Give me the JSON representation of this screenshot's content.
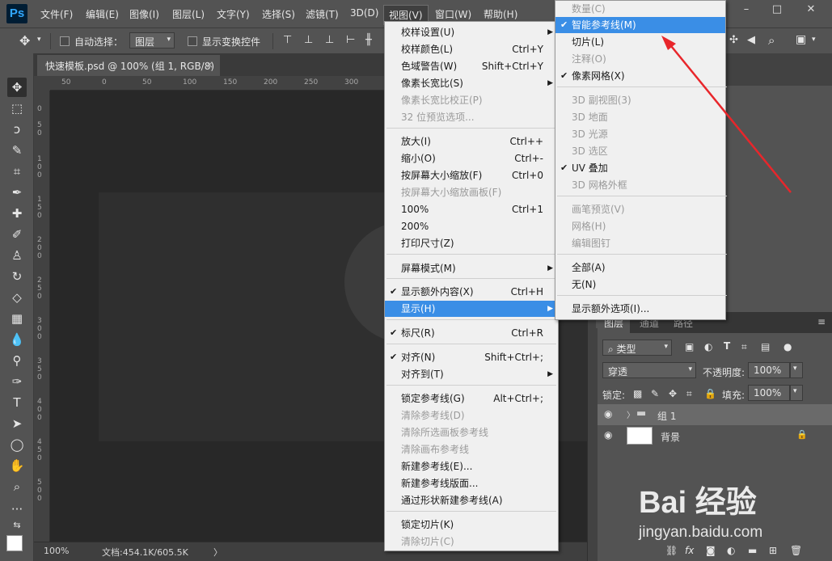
{
  "app": {
    "logo": "Ps",
    "colors": {
      "menu_highlight": "#3a8ee6",
      "menu_bg": "#f0f0f0",
      "ui_dark": "#535353",
      "annotation_arrow": "#e8262b"
    }
  },
  "menubar": {
    "items": [
      "文件(F)",
      "编辑(E)",
      "图像(I)",
      "图层(L)",
      "文字(Y)",
      "选择(S)",
      "滤镜(T)",
      "3D(D)",
      "视图(V)",
      "窗口(W)",
      "帮助(H)"
    ],
    "active": "视图(V)",
    "window_buttons": [
      "–",
      "□",
      "✕"
    ]
  },
  "options_bar": {
    "auto_select_label": "自动选择：",
    "auto_select_target": "图层",
    "show_transform_label": "显示变换控件"
  },
  "document": {
    "tab_title": "快速模板.psd @ 100% (组 1, RGB/8)",
    "tab_close": "×",
    "ruler_h_ticks": [
      "50",
      "0",
      "50",
      "100",
      "150",
      "200",
      "250",
      "300",
      "350"
    ],
    "ruler_v_ticks": [
      "0",
      "5 0",
      "1 0 0",
      "1 5 0",
      "2 0 0",
      "2 5 0",
      "3 0 0",
      "3 5 0",
      "4 0 0",
      "4 5 0",
      "5 0 0"
    ]
  },
  "status_bar": {
    "zoom": "100%",
    "doc_info": "文档:454.1K/605.5K",
    "arrow": "〉"
  },
  "view_menu": {
    "items": [
      {
        "label": "校样设置(U)",
        "shortcut": "",
        "submenu": true,
        "disabled": false,
        "checked": false
      },
      {
        "label": "校样颜色(L)",
        "shortcut": "Ctrl+Y",
        "submenu": false,
        "disabled": false,
        "checked": false
      },
      {
        "label": "色域警告(W)",
        "shortcut": "Shift+Ctrl+Y",
        "submenu": false,
        "disabled": false,
        "checked": false
      },
      {
        "label": "像素长宽比(S)",
        "shortcut": "",
        "submenu": true,
        "disabled": false,
        "checked": false
      },
      {
        "label": "像素长宽比校正(P)",
        "shortcut": "",
        "submenu": false,
        "disabled": true,
        "checked": false
      },
      {
        "label": "32 位预览选项...",
        "shortcut": "",
        "submenu": false,
        "disabled": true,
        "checked": false
      },
      {
        "label": "放大(I)",
        "shortcut": "Ctrl++",
        "submenu": false,
        "disabled": false,
        "checked": false
      },
      {
        "label": "缩小(O)",
        "shortcut": "Ctrl+-",
        "submenu": false,
        "disabled": false,
        "checked": false
      },
      {
        "label": "按屏幕大小缩放(F)",
        "shortcut": "Ctrl+0",
        "submenu": false,
        "disabled": false,
        "checked": false
      },
      {
        "label": "按屏幕大小缩放画板(F)",
        "shortcut": "",
        "submenu": false,
        "disabled": true,
        "checked": false
      },
      {
        "label": "100%",
        "shortcut": "Ctrl+1",
        "submenu": false,
        "disabled": false,
        "checked": false
      },
      {
        "label": "200%",
        "shortcut": "",
        "submenu": false,
        "disabled": false,
        "checked": false
      },
      {
        "label": "打印尺寸(Z)",
        "shortcut": "",
        "submenu": false,
        "disabled": false,
        "checked": false
      },
      {
        "label": "屏幕模式(M)",
        "shortcut": "",
        "submenu": true,
        "disabled": false,
        "checked": false
      },
      {
        "label": "显示额外内容(X)",
        "shortcut": "Ctrl+H",
        "submenu": false,
        "disabled": false,
        "checked": true
      },
      {
        "label": "显示(H)",
        "shortcut": "",
        "submenu": true,
        "disabled": false,
        "checked": false,
        "highlighted": true
      },
      {
        "label": "标尺(R)",
        "shortcut": "Ctrl+R",
        "submenu": false,
        "disabled": false,
        "checked": true
      },
      {
        "label": "对齐(N)",
        "shortcut": "Shift+Ctrl+;",
        "submenu": false,
        "disabled": false,
        "checked": true
      },
      {
        "label": "对齐到(T)",
        "shortcut": "",
        "submenu": true,
        "disabled": false,
        "checked": false
      },
      {
        "label": "锁定参考线(G)",
        "shortcut": "Alt+Ctrl+;",
        "submenu": false,
        "disabled": false,
        "checked": false
      },
      {
        "label": "清除参考线(D)",
        "shortcut": "",
        "submenu": false,
        "disabled": true,
        "checked": false
      },
      {
        "label": "清除所选画板参考线",
        "shortcut": "",
        "submenu": false,
        "disabled": true,
        "checked": false
      },
      {
        "label": "清除画布参考线",
        "shortcut": "",
        "submenu": false,
        "disabled": true,
        "checked": false
      },
      {
        "label": "新建参考线(E)...",
        "shortcut": "",
        "submenu": false,
        "disabled": false,
        "checked": false
      },
      {
        "label": "新建参考线版面...",
        "shortcut": "",
        "submenu": false,
        "disabled": false,
        "checked": false
      },
      {
        "label": "通过形状新建参考线(A)",
        "shortcut": "",
        "submenu": false,
        "disabled": false,
        "checked": false
      },
      {
        "label": "锁定切片(K)",
        "shortcut": "",
        "submenu": false,
        "disabled": false,
        "checked": false
      },
      {
        "label": "清除切片(C)",
        "shortcut": "",
        "submenu": false,
        "disabled": true,
        "checked": false
      }
    ]
  },
  "show_submenu": {
    "items": [
      {
        "label": "数量(C)",
        "disabled": true,
        "checked": false
      },
      {
        "label": "智能参考线(M)",
        "disabled": false,
        "checked": true,
        "highlighted": true
      },
      {
        "label": "切片(L)",
        "disabled": false,
        "checked": false
      },
      {
        "label": "注释(O)",
        "disabled": true,
        "checked": false
      },
      {
        "label": "像素网格(X)",
        "disabled": false,
        "checked": true
      },
      {
        "label": "3D 副视图(3)",
        "disabled": true,
        "checked": false
      },
      {
        "label": "3D 地面",
        "disabled": true,
        "checked": false
      },
      {
        "label": "3D 光源",
        "disabled": true,
        "checked": false
      },
      {
        "label": "3D 选区",
        "disabled": true,
        "checked": false
      },
      {
        "label": "UV 叠加",
        "disabled": false,
        "checked": true
      },
      {
        "label": "3D 网格外框",
        "disabled": true,
        "checked": false
      },
      {
        "label": "画笔预览(V)",
        "disabled": true,
        "checked": false
      },
      {
        "label": "网格(H)",
        "disabled": true,
        "checked": false
      },
      {
        "label": "编辑图钉",
        "disabled": true,
        "checked": false
      },
      {
        "label": "全部(A)",
        "disabled": false,
        "checked": false
      },
      {
        "label": "无(N)",
        "disabled": false,
        "checked": false
      },
      {
        "label": "显示额外选项(I)...",
        "disabled": false,
        "checked": false
      }
    ]
  },
  "layers_panel": {
    "tabs": [
      "图层",
      "通道",
      "路径"
    ],
    "filter_label": "类型",
    "blend_mode": "穿透",
    "opacity_label": "不透明度:",
    "opacity_value": "100%",
    "lock_label": "锁定:",
    "fill_label": "填充:",
    "fill_value": "100%",
    "layers": [
      {
        "name": "组 1",
        "type": "group",
        "selected": true
      },
      {
        "name": "背景",
        "type": "background",
        "selected": false
      }
    ]
  },
  "watermark": {
    "logo": "Bai 经验",
    "url": "jingyan.baidu.com"
  },
  "icons": {
    "check": "✔",
    "submenu_arrow": "▶",
    "eye": "👁",
    "lock": "🔒",
    "folder": "📁",
    "checkmark_glyph_for_menu": "✔"
  }
}
